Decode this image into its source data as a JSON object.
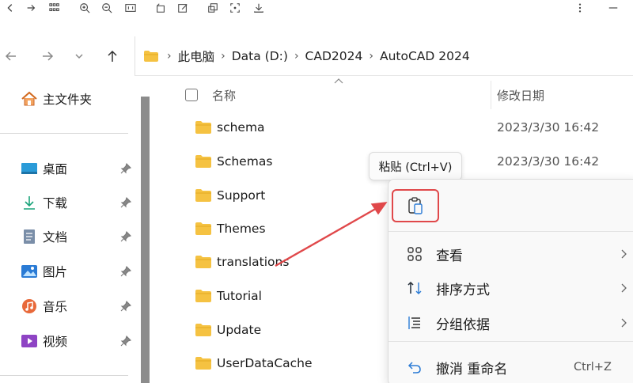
{
  "toolbar": {
    "icons": [
      "back-icon",
      "forward-icon",
      "grid-icon",
      "zoom-in-icon",
      "zoom-out-icon",
      "fit-icon",
      "rotate-icon",
      "edit-icon",
      "copy-icon",
      "crop-icon",
      "save-icon",
      "more-icon",
      "minimize-icon"
    ]
  },
  "nav": {
    "breadcrumb": [
      "此电脑",
      "Data (D:)",
      "CAD2024",
      "AutoCAD 2024"
    ]
  },
  "sidebar": {
    "home_label": "主文件夹",
    "items": [
      {
        "label": "桌面",
        "icon": "desktop-icon"
      },
      {
        "label": "下载",
        "icon": "download-icon"
      },
      {
        "label": "文档",
        "icon": "document-icon"
      },
      {
        "label": "图片",
        "icon": "pictures-icon"
      },
      {
        "label": "音乐",
        "icon": "music-icon"
      },
      {
        "label": "视频",
        "icon": "video-icon"
      }
    ]
  },
  "list": {
    "col_name": "名称",
    "col_date": "修改日期",
    "rows": [
      {
        "name": "schema",
        "date": "2023/3/30 16:42"
      },
      {
        "name": "Schemas",
        "date": "2023/3/30 16:42"
      },
      {
        "name": "Support",
        "date": ""
      },
      {
        "name": "Themes",
        "date": ""
      },
      {
        "name": "translations",
        "date": ""
      },
      {
        "name": "Tutorial",
        "date": ""
      },
      {
        "name": "Update",
        "date": ""
      },
      {
        "name": "UserDataCache",
        "date": ""
      }
    ]
  },
  "tooltip": {
    "text": "粘贴 (Ctrl+V)"
  },
  "menu": {
    "items": [
      {
        "label": "查看",
        "icon": "view-grid-icon",
        "submenu": true
      },
      {
        "label": "排序方式",
        "icon": "sort-icon",
        "submenu": true
      },
      {
        "label": "分组依据",
        "icon": "group-icon",
        "submenu": true
      },
      {
        "label": "撤消 重命名",
        "icon": "undo-icon",
        "shortcut": "Ctrl+Z"
      }
    ]
  },
  "colors": {
    "folder": "#f5c242",
    "highlight": "#e0484a",
    "accent": "#2a7bd5"
  }
}
